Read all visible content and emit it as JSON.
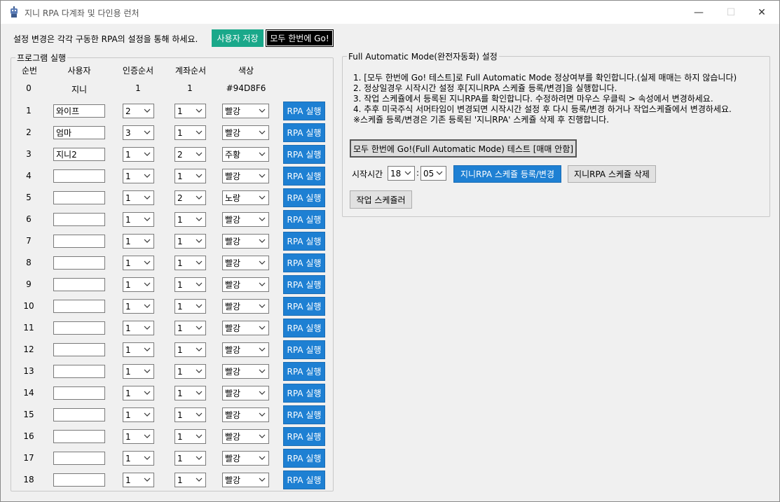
{
  "window": {
    "title": "지니 RPA 다계좌 및 다인용 런처",
    "minimize": "—",
    "maximize": "☐",
    "close": "✕"
  },
  "top": {
    "note": "설정 변경은 각각 구동한 RPA의 설정을 통해 하세요.",
    "save_user_label": "사용자 저장",
    "all_go_label": "모두 한번에 Go!"
  },
  "program_group": {
    "legend": "프로그램 실행",
    "headers": [
      "순번",
      "사용자",
      "인증순서",
      "계좌순서",
      "색상"
    ],
    "row0": {
      "num": "0",
      "user": "지니",
      "auth": "1",
      "account": "1",
      "color": "#94D8F6"
    },
    "rows": [
      {
        "num": "1",
        "user": "와이프",
        "auth": "2",
        "account": "1",
        "color": "빨강"
      },
      {
        "num": "2",
        "user": "엄마",
        "auth": "3",
        "account": "1",
        "color": "빨강"
      },
      {
        "num": "3",
        "user": "지니2",
        "auth": "1",
        "account": "2",
        "color": "주황"
      },
      {
        "num": "4",
        "user": "",
        "auth": "1",
        "account": "1",
        "color": "빨강"
      },
      {
        "num": "5",
        "user": "",
        "auth": "1",
        "account": "2",
        "color": "노랑"
      },
      {
        "num": "6",
        "user": "",
        "auth": "1",
        "account": "1",
        "color": "빨강"
      },
      {
        "num": "7",
        "user": "",
        "auth": "1",
        "account": "1",
        "color": "빨강"
      },
      {
        "num": "8",
        "user": "",
        "auth": "1",
        "account": "1",
        "color": "빨강"
      },
      {
        "num": "9",
        "user": "",
        "auth": "1",
        "account": "1",
        "color": "빨강"
      },
      {
        "num": "10",
        "user": "",
        "auth": "1",
        "account": "1",
        "color": "빨강"
      },
      {
        "num": "11",
        "user": "",
        "auth": "1",
        "account": "1",
        "color": "빨강"
      },
      {
        "num": "12",
        "user": "",
        "auth": "1",
        "account": "1",
        "color": "빨강"
      },
      {
        "num": "13",
        "user": "",
        "auth": "1",
        "account": "1",
        "color": "빨강"
      },
      {
        "num": "14",
        "user": "",
        "auth": "1",
        "account": "1",
        "color": "빨강"
      },
      {
        "num": "15",
        "user": "",
        "auth": "1",
        "account": "1",
        "color": "빨강"
      },
      {
        "num": "16",
        "user": "",
        "auth": "1",
        "account": "1",
        "color": "빨강"
      },
      {
        "num": "17",
        "user": "",
        "auth": "1",
        "account": "1",
        "color": "빨강"
      },
      {
        "num": "18",
        "user": "",
        "auth": "1",
        "account": "1",
        "color": "빨강"
      }
    ],
    "rpa_button_label": "RPA 실행"
  },
  "auto_group": {
    "legend": "Full Automatic Mode(완전자동화) 설정",
    "lines": [
      "1. [모두 한번에 Go! 테스트]로 Full Automatic Mode 정상여부를 확인합니다.(실제 매매는 하지 않습니다)",
      "2. 정상일경우 시작시간 설정 후[지니RPA 스케쥴 등록/변경]을 실행합니다.",
      "3. 작업 스케쥴에서 등록된 지니RPA를 확인합니다. 수정하려면 마우스 우클릭 > 속성에서 변경하세요.",
      "4. 추후 미국주식 서머타임이 변경되면 시작시간 설정 후 다시 등록/변경 하거나 작업스케쥴에서 변경하세요.",
      "※스케쥴 등록/변경은 기존 등록된 '지니RPA' 스케쥴 삭제 후 진행합니다."
    ],
    "test_button_label": "모두 한번에 Go!(Full Automatic Mode) 테스트 [매매 안함]",
    "start_time_label": "시작시간",
    "hour": "18",
    "colon": ":",
    "minute": "05",
    "register_button_label": "지니RPA 스케쥴 등록/변경",
    "delete_button_label": "지니RPA 스케쥴 삭제",
    "scheduler_button_label": "작업 스케쥴러"
  }
}
